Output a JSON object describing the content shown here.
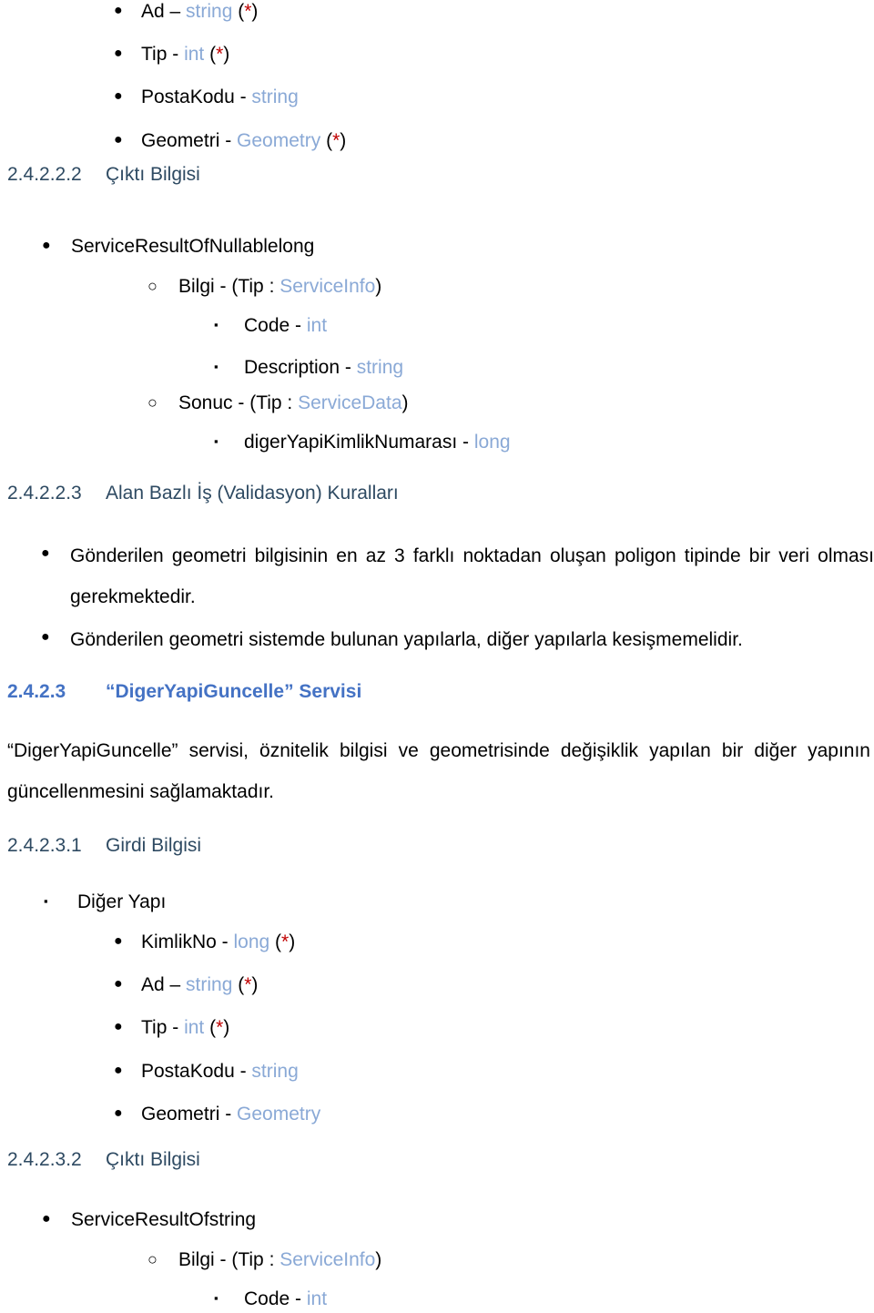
{
  "document": {
    "language": "tr",
    "colors": {
      "type_token": "#8AA9D6",
      "required_star": "#C00000",
      "heading_level4": "#2E4A62",
      "heading_level3": "#4472C4",
      "body": "#000000"
    }
  },
  "top_fields": [
    {
      "name": "Ad – ",
      "type": "string",
      "required": " (*)"
    },
    {
      "name": "Tip - ",
      "type": "int",
      "required": " (*)"
    },
    {
      "name": "PostaKodu - ",
      "type": "string",
      "required": ""
    },
    {
      "name": "Geometri - ",
      "type": "Geometry",
      "required": " (*)"
    }
  ],
  "section_2_4_2_2_2": {
    "number": "2.4.2.2.2",
    "title": "Çıktı Bilgisi",
    "root": "ServiceResultOfNullablelong",
    "members": [
      {
        "label_plain": "Bilgi -  (Tip : ",
        "label_type": "ServiceInfo",
        "label_tail": ")",
        "children": [
          {
            "name": "Code - ",
            "type": "int"
          },
          {
            "name": "Description - ",
            "type": "string"
          }
        ]
      },
      {
        "label_plain": "Sonuc -  (Tip : ",
        "label_type": "ServiceData",
        "label_tail": ")",
        "children": [
          {
            "name": "digerYapiKimlikNumarası - ",
            "type": "long"
          }
        ]
      }
    ]
  },
  "section_2_4_2_2_3": {
    "number": "2.4.2.2.3",
    "title": "Alan Bazlı İş (Validasyon) Kuralları",
    "rules": [
      "Gönderilen geometri bilgisinin en az 3 farklı noktadan oluşan poligon tipinde bir veri olması gerekmektedir.",
      "Gönderilen geometri sistemde bulunan yapılarla, diğer yapılarla kesişmemelidir."
    ]
  },
  "section_2_4_2_3": {
    "number": "2.4.2.3",
    "title": "“DigerYapiGuncelle” Servisi",
    "paragraph": "“DigerYapiGuncelle” servisi, öznitelik bilgisi ve geometrisinde değişiklik yapılan bir diğer yapının güncellenmesini sağlamaktadır."
  },
  "section_2_4_2_3_1": {
    "number": "2.4.2.3.1",
    "title": "Girdi Bilgisi",
    "group": "Diğer Yapı",
    "fields": [
      {
        "name": "KimlikNo - ",
        "type": "long",
        "required": " (*)"
      },
      {
        "name": "Ad – ",
        "type": "string",
        "required": " (*)"
      },
      {
        "name": "Tip - ",
        "type": "int",
        "required": " (*)"
      },
      {
        "name": "PostaKodu - ",
        "type": "string",
        "required": ""
      },
      {
        "name": "Geometri - ",
        "type": "Geometry",
        "required": ""
      }
    ]
  },
  "section_2_4_2_3_2": {
    "number": "2.4.2.3.2",
    "title": "Çıktı Bilgisi",
    "root": "ServiceResultOfstring",
    "member": {
      "label_plain": "Bilgi -  (Tip : ",
      "label_type": "ServiceInfo",
      "label_tail": ")",
      "children": [
        {
          "name": "Code - ",
          "type": "int"
        }
      ]
    }
  },
  "markers": {
    "disc": "●",
    "circle": "○",
    "square": "▪"
  }
}
